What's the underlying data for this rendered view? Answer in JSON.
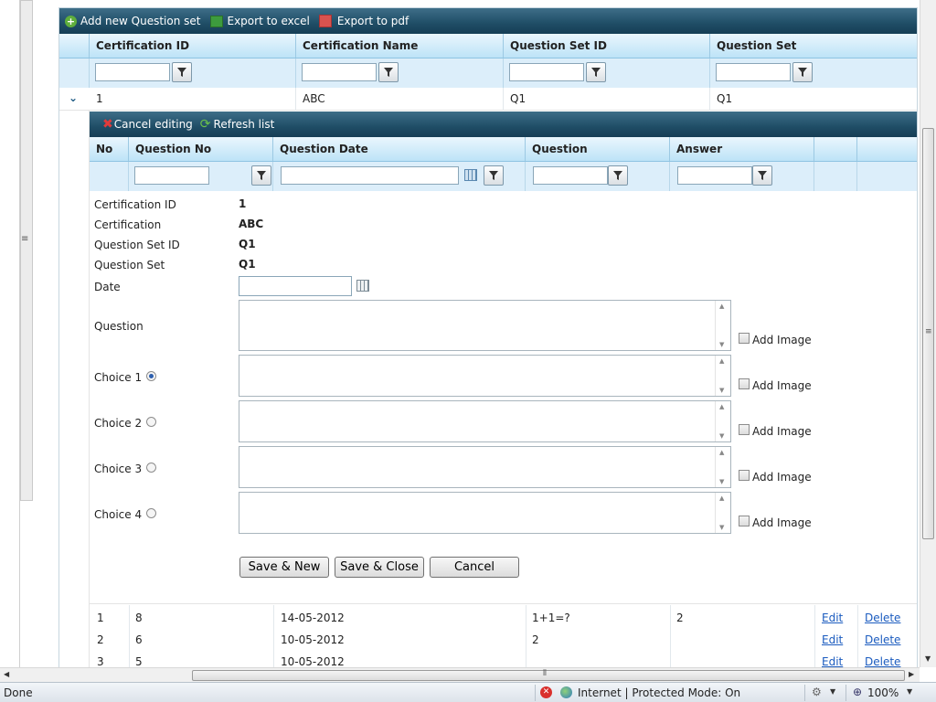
{
  "toolbar": {
    "add_label": "Add new Question set",
    "excel_label": "Export to excel",
    "pdf_label": "Export to pdf"
  },
  "outer_grid": {
    "columns": [
      "Certification ID",
      "Certification Name",
      "Question Set ID",
      "Question Set"
    ],
    "row": {
      "cert_id": "1",
      "cert_name": "ABC",
      "qset_id": "Q1",
      "qset": "Q1"
    }
  },
  "inner_toolbar": {
    "cancel_label": "Cancel editing",
    "refresh_label": "Refresh list"
  },
  "inner_grid": {
    "columns": [
      "No",
      "Question No",
      "Question Date",
      "Question",
      "Answer",
      "",
      ""
    ],
    "rows": [
      {
        "no": "1",
        "qno": "8",
        "date": "14-05-2012",
        "question": "1+1=?",
        "answer": "2",
        "edit": "Edit",
        "delete": "Delete"
      },
      {
        "no": "2",
        "qno": "6",
        "date": "10-05-2012",
        "question": "2",
        "answer": "",
        "edit": "Edit",
        "delete": "Delete"
      },
      {
        "no": "3",
        "qno": "5",
        "date": "10-05-2012",
        "question": "",
        "answer": "",
        "edit": "Edit",
        "delete": "Delete"
      }
    ]
  },
  "form": {
    "cert_id_label": "Certification ID",
    "cert_id_value": "1",
    "cert_label": "Certification",
    "cert_value": "ABC",
    "qset_id_label": "Question Set ID",
    "qset_id_value": "Q1",
    "qset_label": "Question Set",
    "qset_value": "Q1",
    "date_label": "Date",
    "date_value": "",
    "question_label": "Question",
    "choices": [
      "Choice 1",
      "Choice 2",
      "Choice 3",
      "Choice 4"
    ],
    "selected_choice": "Choice 1",
    "add_image_label": "Add Image",
    "save_new": "Save & New",
    "save_close": "Save & Close",
    "cancel": "Cancel"
  },
  "statusbar": {
    "status": "Done",
    "zone": "Internet | Protected Mode: On",
    "zoom": "100%"
  },
  "colors": {
    "toolbar_bg": "#1f4d66",
    "header_bg": "#bde3f7",
    "filter_bg": "#dceefa",
    "link": "#1a5bbf"
  }
}
